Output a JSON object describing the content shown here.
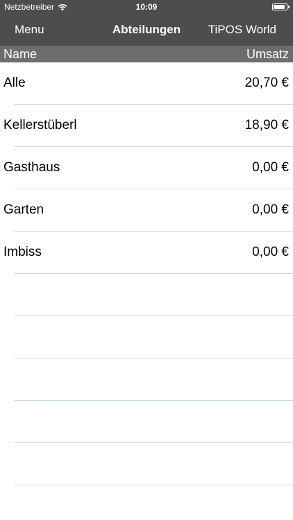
{
  "status_bar": {
    "carrier": "Netzbetreiber",
    "time": "10:09",
    "wifi_icon": "wifi-icon",
    "battery_icon": "battery-icon",
    "battery_level": 0.9
  },
  "nav": {
    "left_label": "Menu",
    "title": "Abteilungen",
    "right_label": "TiPOS World"
  },
  "table": {
    "headers": {
      "name": "Name",
      "revenue": "Umsatz"
    },
    "rows": [
      {
        "name": "Alle",
        "revenue": "20,70 €"
      },
      {
        "name": "Kellerstüberl",
        "revenue": "18,90 €"
      },
      {
        "name": "Gasthaus",
        "revenue": "0,00 €"
      },
      {
        "name": "Garten",
        "revenue": "0,00 €"
      },
      {
        "name": "Imbiss",
        "revenue": "0,00 €"
      }
    ]
  },
  "colors": {
    "bar": "#4d4d4d",
    "header": "#6d6d6d",
    "separator": "#c7dbe6"
  }
}
